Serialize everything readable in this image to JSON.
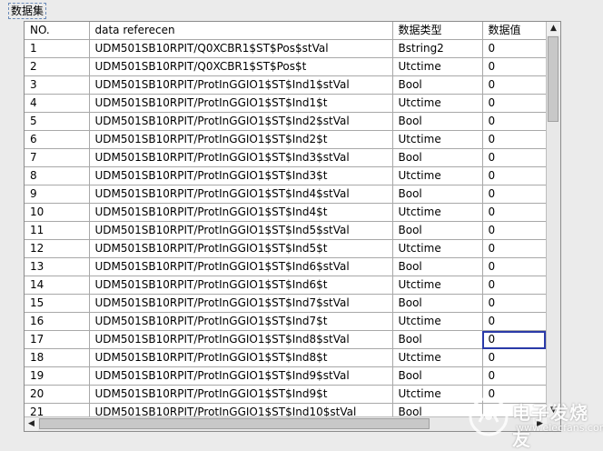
{
  "control_label": "数据集",
  "table": {
    "headers": [
      "NO.",
      "data referecen",
      "数据类型",
      "数据值"
    ],
    "rows": [
      [
        "1",
        "UDM501SB10RPIT/Q0XCBR1$ST$Pos$stVal",
        "Bstring2",
        "0"
      ],
      [
        "2",
        "UDM501SB10RPIT/Q0XCBR1$ST$Pos$t",
        "Utctime",
        "0"
      ],
      [
        "3",
        "UDM501SB10RPIT/ProtInGGIO1$ST$Ind1$stVal",
        "Bool",
        "0"
      ],
      [
        "4",
        "UDM501SB10RPIT/ProtInGGIO1$ST$Ind1$t",
        "Utctime",
        "0"
      ],
      [
        "5",
        "UDM501SB10RPIT/ProtInGGIO1$ST$Ind2$stVal",
        "Bool",
        "0"
      ],
      [
        "6",
        "UDM501SB10RPIT/ProtInGGIO1$ST$Ind2$t",
        "Utctime",
        "0"
      ],
      [
        "7",
        "UDM501SB10RPIT/ProtInGGIO1$ST$Ind3$stVal",
        "Bool",
        "0"
      ],
      [
        "8",
        "UDM501SB10RPIT/ProtInGGIO1$ST$Ind3$t",
        "Utctime",
        "0"
      ],
      [
        "9",
        "UDM501SB10RPIT/ProtInGGIO1$ST$Ind4$stVal",
        "Bool",
        "0"
      ],
      [
        "10",
        "UDM501SB10RPIT/ProtInGGIO1$ST$Ind4$t",
        "Utctime",
        "0"
      ],
      [
        "11",
        "UDM501SB10RPIT/ProtInGGIO1$ST$Ind5$stVal",
        "Bool",
        "0"
      ],
      [
        "12",
        "UDM501SB10RPIT/ProtInGGIO1$ST$Ind5$t",
        "Utctime",
        "0"
      ],
      [
        "13",
        "UDM501SB10RPIT/ProtInGGIO1$ST$Ind6$stVal",
        "Bool",
        "0"
      ],
      [
        "14",
        "UDM501SB10RPIT/ProtInGGIO1$ST$Ind6$t",
        "Utctime",
        "0"
      ],
      [
        "15",
        "UDM501SB10RPIT/ProtInGGIO1$ST$Ind7$stVal",
        "Bool",
        "0"
      ],
      [
        "16",
        "UDM501SB10RPIT/ProtInGGIO1$ST$Ind7$t",
        "Utctime",
        "0"
      ],
      [
        "17",
        "UDM501SB10RPIT/ProtInGGIO1$ST$Ind8$stVal",
        "Bool",
        "0"
      ],
      [
        "18",
        "UDM501SB10RPIT/ProtInGGIO1$ST$Ind8$t",
        "Utctime",
        "0"
      ],
      [
        "19",
        "UDM501SB10RPIT/ProtInGGIO1$ST$Ind9$stVal",
        "Bool",
        "0"
      ],
      [
        "20",
        "UDM501SB10RPIT/ProtInGGIO1$ST$Ind9$t",
        "Utctime",
        "0"
      ],
      [
        "21",
        "UDM501SB10RPIT/ProtInGGIO1$ST$Ind10$stVal",
        "Bool",
        ""
      ]
    ],
    "selected_row": 16,
    "selected_col": 3
  },
  "watermark": {
    "brand": "电子发烧友",
    "site": "www.elecfans.com"
  }
}
